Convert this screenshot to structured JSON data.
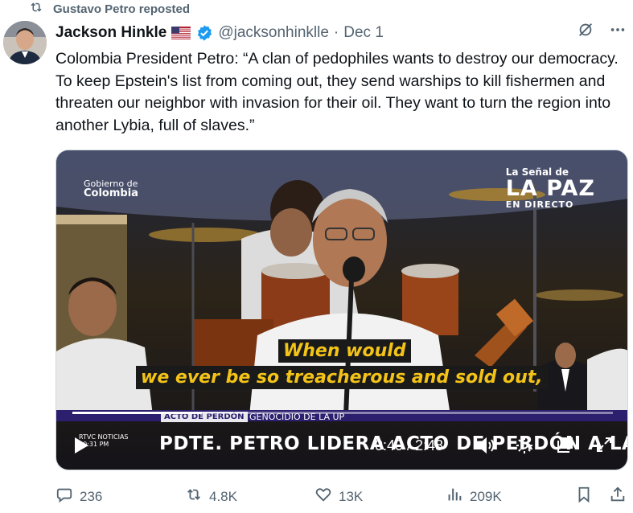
{
  "repost": {
    "label": "Gustavo Petro reposted",
    "icon": "repost-icon"
  },
  "author": {
    "name": "Jackson Hinkle",
    "flag": "🇺🇸",
    "handle": "@jacksonhinklle",
    "separator": "·",
    "date": "Dec 1",
    "verified": true
  },
  "tweet": {
    "text": "Colombia President Petro: “A clan of pedophiles wants to destroy our democracy. To keep Epstein's list from coming out, they send warships to kill fishermen and threaten our neighbor with invasion for their oil. They want to turn the region into another Lybia, full of slaves.”"
  },
  "video": {
    "gov_logo": {
      "line1": "Gobierno de",
      "line2": "Colombia"
    },
    "channel": {
      "line1": "La Señal de",
      "brand": "LA PAZ",
      "line3": "EN DIRECTO"
    },
    "subtitle_line1": "When would",
    "subtitle_line2": "we ever be so treacherous and sold out,",
    "ticker_tag": "ACTO DE PERDÓN",
    "ticker_topic": "GENOCIDIO DE LA UP",
    "headline": "PDTE. PETRO LIDERA ACTO DE PERDÓN A LAS VÍCTIMAS",
    "rtvc": {
      "line1": "RTVC NOTICIAS",
      "line2": "10:31 PM"
    },
    "time_display": "0:40 / 2:48",
    "progress": 0.24
  },
  "metrics": {
    "replies": "236",
    "reposts": "4.8K",
    "likes": "13K",
    "views": "209K"
  },
  "colors": {
    "text": "#0f1419",
    "secondary": "#536471",
    "verified": "#1d9bf0",
    "subtitle": "#f3c318"
  }
}
